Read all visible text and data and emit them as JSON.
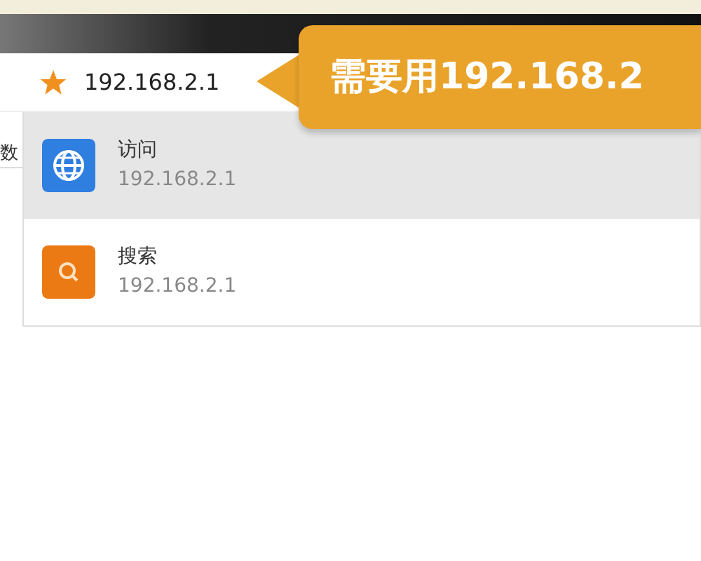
{
  "address_bar": {
    "value": "192.168.2.1",
    "bookmarked": true
  },
  "side_tab": {
    "label": "数"
  },
  "suggestions": [
    {
      "kind": "visit",
      "title": "访问",
      "url": "192.168.2.1",
      "selected": true
    },
    {
      "kind": "search",
      "title": "搜索",
      "url": "192.168.2.1",
      "selected": false
    }
  ],
  "callout": {
    "text": "需要用192.168.2"
  }
}
